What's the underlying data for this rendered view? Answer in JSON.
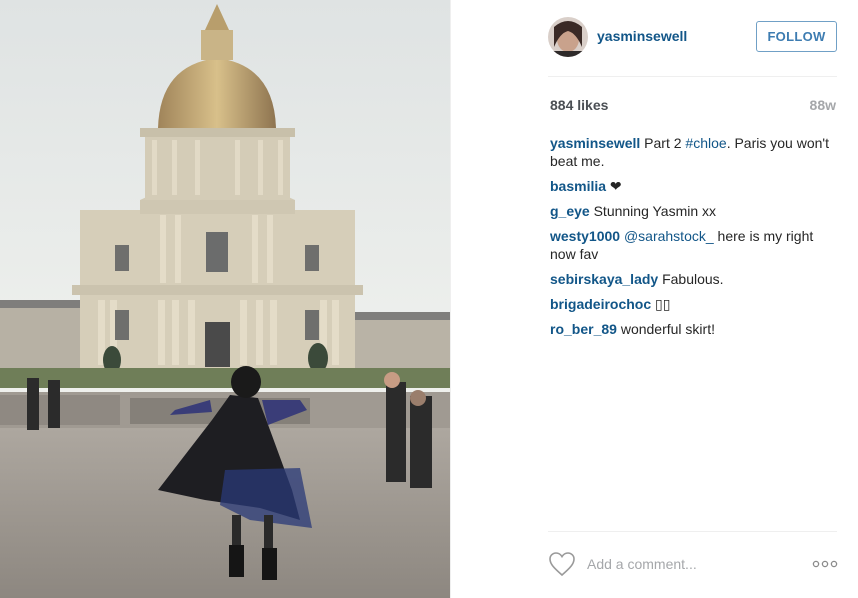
{
  "post": {
    "image_alt": "Woman in a black coat twirling in front of Les Invalides dome in Paris",
    "author": "yasminsewell",
    "follow_label": "FOLLOW",
    "likes": "884 likes",
    "age": "88w"
  },
  "caption": {
    "user": "yasminsewell",
    "text_before": " Part 2 ",
    "hashtag": "#chloe",
    "text_after": ". Paris you won't beat me."
  },
  "comments": [
    {
      "user": "basmilia",
      "text": " ❤"
    },
    {
      "user": "g_eye",
      "text": " Stunning Yasmin xx"
    },
    {
      "user": "westy1000",
      "mention": " @sarahstock_",
      "text": " here is my right now fav"
    },
    {
      "user": "sebirskaya_lady",
      "text": " Fabulous."
    },
    {
      "user": "brigadeirochoc",
      "text": " ▯▯"
    },
    {
      "user": "ro_ber_89",
      "text": " wonderful skirt!"
    }
  ],
  "footer": {
    "comment_placeholder": "Add a comment...",
    "more_label": "◦◦◦"
  },
  "icons": {
    "like": "heart-outline-icon",
    "more": "ellipsis-icon"
  },
  "colors": {
    "username": "#125688",
    "follow_border": "#70a0c6",
    "muted": "#a5a7aa"
  }
}
